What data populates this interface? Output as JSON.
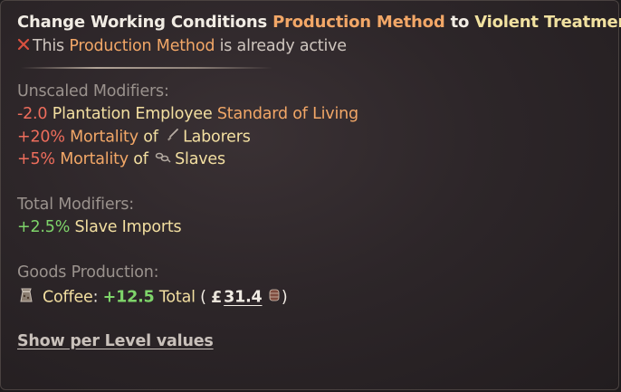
{
  "tooltip": {
    "title": {
      "prefix": "Change Working Conditions ",
      "method_label": "Production Method",
      "middle": " to ",
      "target": "Violent Treatment"
    },
    "status": {
      "icon": "cross-icon",
      "prefix": "This ",
      "method_label": "Production Method",
      "suffix": " is already active"
    },
    "unscaled": {
      "heading": "Unscaled Modifiers:",
      "rows": [
        {
          "value": "-2.0",
          "parts": [
            "Plantation Employee",
            "Standard of Living"
          ]
        },
        {
          "value": "+20%",
          "stat": "Mortality",
          "of": " of ",
          "icon": "shovel-icon",
          "pop": "Laborers"
        },
        {
          "value": "+5%",
          "stat": "Mortality",
          "of": " of ",
          "icon": "chains-icon",
          "pop": "Slaves"
        }
      ]
    },
    "total": {
      "heading": "Total Modifiers:",
      "row": {
        "value": "+2.5%",
        "label": "Slave Imports"
      }
    },
    "goods": {
      "heading": "Goods Production:",
      "icon": "coffee-sack-icon",
      "good": "Coffee",
      "colon": ":",
      "amount": "+12.5",
      "total_label": "Total",
      "open_paren": "(",
      "currency_icon": "pound-icon",
      "currency_symbol": "£",
      "price": "31.4",
      "price_icon": "barrel-icon",
      "close_paren": ")"
    },
    "footer_link": "Show per Level values"
  },
  "colors": {
    "white": "#f1ece4",
    "orange": "#f2a767",
    "gold": "#f1e1a0",
    "red": "#ee6d5c",
    "green": "#7ed46a",
    "grey": "#9a928d"
  }
}
